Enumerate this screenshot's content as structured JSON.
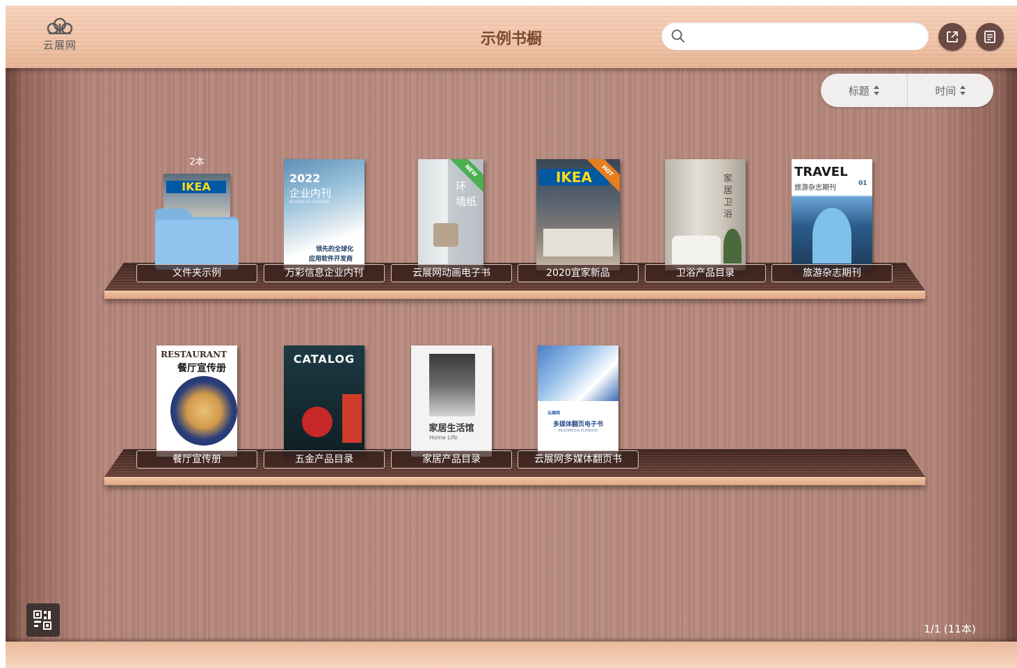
{
  "header": {
    "logo_text": "云展网",
    "title": "示例书橱",
    "search_placeholder": "",
    "share_icon": "share-icon",
    "list_icon": "list-icon"
  },
  "sort": {
    "title_label": "标题",
    "time_label": "时间"
  },
  "shelves": [
    {
      "books": [
        {
          "label": "文件夹示例",
          "type": "folder",
          "count": "2本"
        },
        {
          "label": "万彩信息企业内刊",
          "cover_text": [
            "2022",
            "企业内刊",
            "BUSINESS JOURNAL",
            "领先的全球化",
            "应用软件开发商"
          ]
        },
        {
          "label": "云展网动画电子书",
          "cover_text": [
            "环",
            "墙纸"
          ],
          "ribbon": "NEW"
        },
        {
          "label": "2020宜家新品",
          "cover_text": [
            "IKEA"
          ],
          "ribbon": "HOT"
        },
        {
          "label": "卫浴产品目录",
          "cover_text": [
            "家居卫浴"
          ]
        },
        {
          "label": "旅游杂志期刊",
          "cover_text": [
            "TRAVEL",
            "旅游杂志期刊",
            "01"
          ]
        }
      ]
    },
    {
      "books": [
        {
          "label": "餐厅宣传册",
          "cover_text": [
            "RESTAURANT",
            "餐厅宣传册"
          ]
        },
        {
          "label": "五金产品目录",
          "cover_text": [
            "CATALOG"
          ]
        },
        {
          "label": "家居产品目录",
          "cover_text": [
            "家居生活馆",
            "Home Life"
          ]
        },
        {
          "label": "云展网多媒体翻页书",
          "cover_text": [
            "云展网",
            "多媒体翻页电子书",
            "MULTIMEDIA FLIPBOOK"
          ]
        }
      ]
    }
  ],
  "footer": {
    "qr_icon": "qr-code-icon",
    "pager": "1/1 (11本)"
  },
  "colors": {
    "title": "#7a4a2c",
    "round_button": "#6b4a43",
    "label_bg": "#3c231e",
    "ribbon_new": "#4caf50",
    "ribbon_hot": "#e67e22"
  }
}
